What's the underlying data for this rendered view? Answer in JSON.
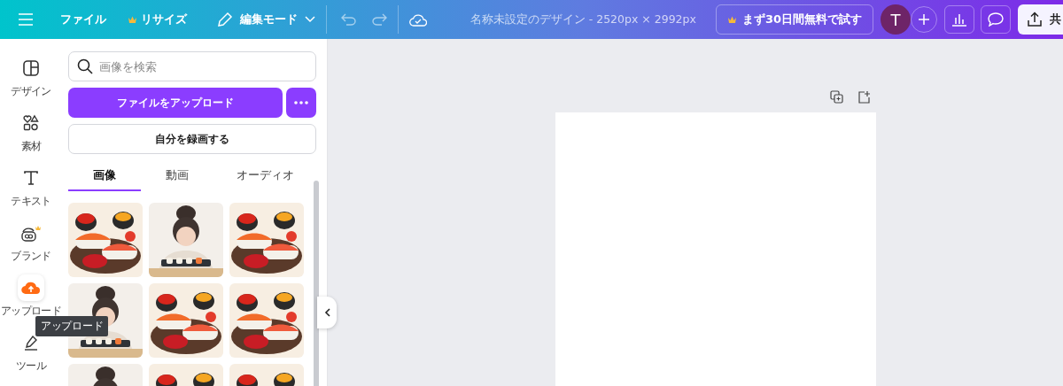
{
  "topbar": {
    "file": "ファイル",
    "resize": "リサイズ",
    "mode": "編集モード",
    "title": "名称未設定のデザイン - 2520px × 2992px",
    "trial": "まず30日間無料で試す",
    "avatar": "T",
    "share": "共"
  },
  "rail": [
    {
      "label": "デザイン",
      "selected": false
    },
    {
      "label": "素材",
      "selected": false
    },
    {
      "label": "テキスト",
      "selected": false
    },
    {
      "label": "ブランド",
      "selected": false
    },
    {
      "label": "アップロード",
      "selected": true
    },
    {
      "label": "ツール",
      "selected": false
    }
  ],
  "tooltip": "アップロード",
  "panel": {
    "search": {
      "placeholder": "画像を検索"
    },
    "upload_button": "ファイルをアップロード",
    "record_button": "自分を録画する",
    "tabs": [
      {
        "label": "画像",
        "selected": true
      },
      {
        "label": "動画",
        "selected": false
      },
      {
        "label": "オーディオ",
        "selected": false
      }
    ]
  }
}
